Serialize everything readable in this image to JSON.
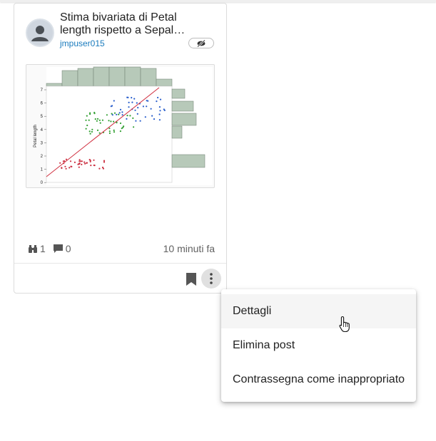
{
  "post": {
    "title": "Stima bivariata di Petal length rispetto a Sepal length",
    "author": "jmpuser015",
    "visibility_icon": "eye-off-icon",
    "views": "1",
    "comments": "0",
    "time": "10 minuti fa"
  },
  "thumbnail": {
    "ylabel": "Petal length",
    "y_ticks": [
      "7",
      "6",
      "5",
      "4",
      "3",
      "2",
      "1",
      "0"
    ]
  },
  "icons": {
    "views": "binoculars-icon",
    "comments": "comment-icon",
    "bookmark": "bookmark-icon",
    "more": "more-vert-icon"
  },
  "menu": {
    "items": [
      {
        "label": "Dettagli"
      },
      {
        "label": "Elimina post"
      },
      {
        "label": "Contrassegna come inappropriato"
      }
    ]
  },
  "colors": {
    "setosa": "#cc3344",
    "versicolor": "#33a033",
    "virginica": "#2a5fcc",
    "histogram": "#b7c9b9",
    "author_link": "#1a7bbd"
  }
}
